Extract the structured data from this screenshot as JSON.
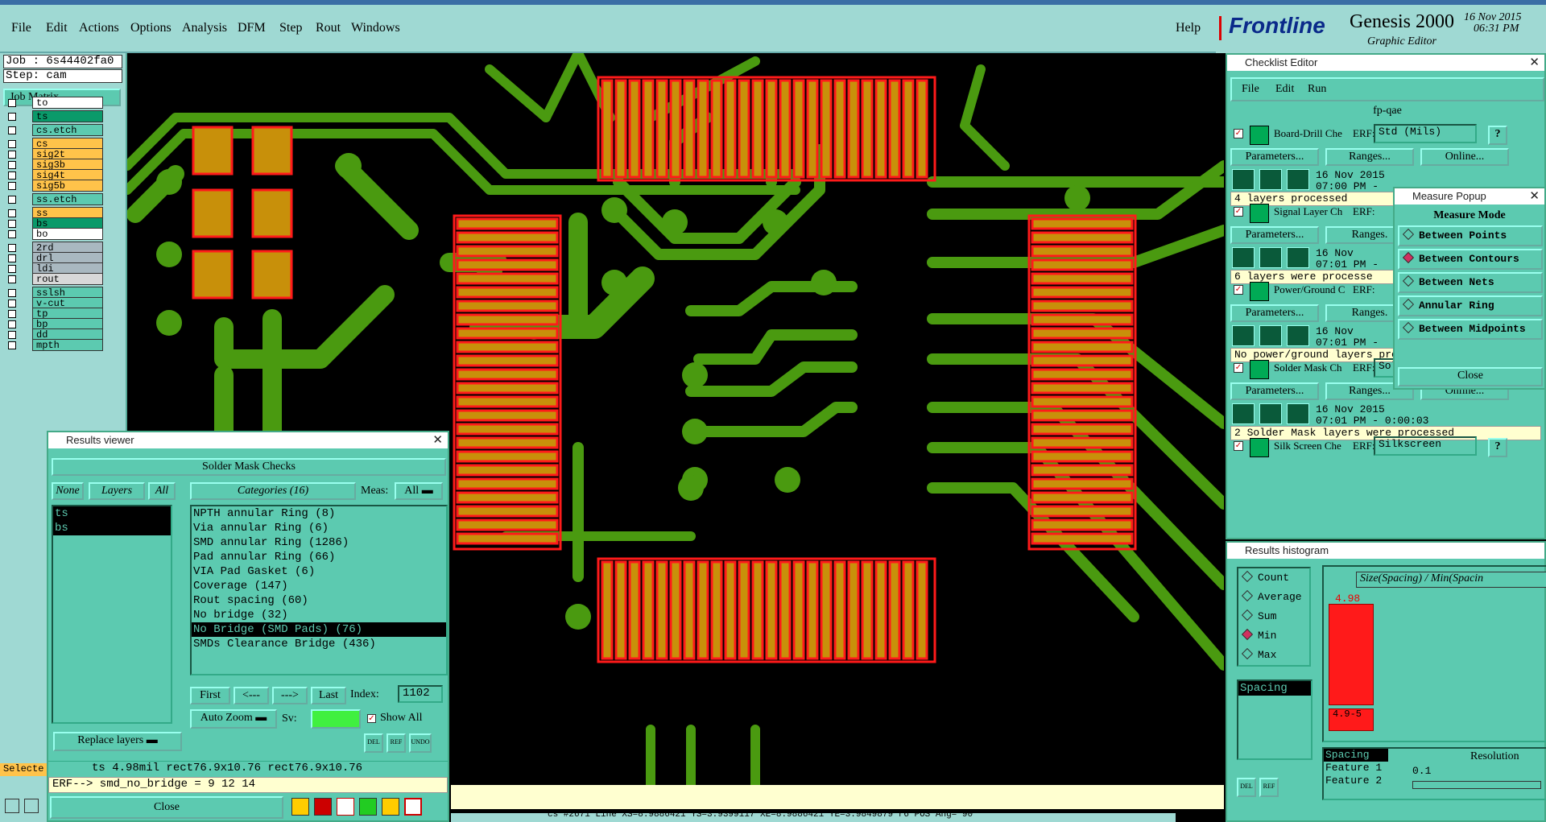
{
  "menu": {
    "items": [
      "File",
      "Edit",
      "Actions",
      "Options",
      "Analysis",
      "DFM",
      "Step",
      "Rout",
      "Windows"
    ],
    "help": "Help"
  },
  "brand": {
    "logo": "Frontline",
    "product": "Genesis 2000",
    "subtitle": "Graphic Editor",
    "date": "16 Nov 2015",
    "time": "06:31 PM"
  },
  "left": {
    "job": "Job : 6s44402fa0",
    "step": "Step: cam",
    "job_matrix": "Job Matrix ...",
    "layers": [
      {
        "name": "to",
        "color": "#ffffff"
      },
      {
        "name": "ts",
        "color": "#0a9a6a"
      },
      {
        "name": "cs.etch",
        "color": "#5ccab0"
      },
      {
        "name": "cs",
        "color": "#ffc34a"
      },
      {
        "name": "sig2t",
        "color": "#ffc34a"
      },
      {
        "name": "sig3b",
        "color": "#ffc34a"
      },
      {
        "name": "sig4t",
        "color": "#ffc34a"
      },
      {
        "name": "sig5b",
        "color": "#ffc34a"
      },
      {
        "name": "ss.etch",
        "color": "#5ccab0"
      },
      {
        "name": "ss",
        "color": "#ffc34a"
      },
      {
        "name": "bs",
        "color": "#0a9a6a"
      },
      {
        "name": "bo",
        "color": "#ffffff"
      },
      {
        "name": "2rd",
        "color": "#a9b8c0"
      },
      {
        "name": "drl",
        "color": "#a9b8c0"
      },
      {
        "name": "ldi",
        "color": "#a9b8c0"
      },
      {
        "name": "rout",
        "color": "#d8d8d8"
      },
      {
        "name": "sslsh",
        "color": "#5ccab0"
      },
      {
        "name": "v-cut",
        "color": "#5ccab0"
      },
      {
        "name": "tp",
        "color": "#5ccab0"
      },
      {
        "name": "bp",
        "color": "#5ccab0"
      },
      {
        "name": "dd",
        "color": "#5ccab0"
      },
      {
        "name": "mpth",
        "color": "#5ccab0"
      }
    ],
    "select_label": "Selecte"
  },
  "results_viewer": {
    "title": "Results viewer",
    "header": "Solder Mask Checks",
    "none_btn": "None",
    "layers_btn": "Layers",
    "all_btn": "All",
    "categories_label": "Categories (16)",
    "meas_label": "Meas:",
    "meas_value": "All",
    "layer_list": [
      "ts",
      "bs"
    ],
    "categories": [
      "NPTH annular Ring (8)",
      "Via annular Ring (6)",
      "SMD annular Ring (1286)",
      "Pad annular Ring (66)",
      "VIA Pad Gasket (6)",
      "Coverage (147)",
      "Rout spacing (60)",
      "No bridge (32)",
      "No Bridge (SMD Pads) (76)",
      "SMDs Clearance Bridge (436)"
    ],
    "selected_category": 8,
    "first": "First",
    "prev": "<---",
    "next": "--->",
    "last": "Last",
    "index_label": "Index:",
    "index_value": "1102",
    "auto_zoom": "Auto Zoom",
    "sv_label": "Sv:",
    "show_all": "Show All",
    "replace_layers": "Replace layers",
    "info_line": "ts 4.98mil   rect76.9x10.76   rect76.9x10.76",
    "erf_line": "ERF--> smd_no_bridge = 9 12 14",
    "close": "Close",
    "icons": [
      "DEL",
      "REF",
      "UNDO"
    ]
  },
  "checklist": {
    "title": "Checklist Editor",
    "menu": [
      "File",
      "Edit",
      "Run"
    ],
    "name": "fp-qae",
    "items": [
      {
        "name": "Board-Drill Che",
        "erf": "Std (Mils)",
        "params": "Parameters...",
        "ranges": "Ranges...",
        "online": "Online...",
        "date": "16 Nov 2015",
        "time": "07:00 PM -",
        "status": "4 layers processed"
      },
      {
        "name": "Signal Layer Ch",
        "erf": "",
        "params": "Parameters...",
        "ranges": "Ranges.",
        "online": "",
        "date": "16 Nov",
        "time": "07:01 PM -",
        "status": "6 layers were processe"
      },
      {
        "name": "Power/Ground C",
        "erf": "",
        "params": "Parameters...",
        "ranges": "Ranges.",
        "online": "",
        "date": "16 Nov",
        "time": "07:01 PM -",
        "status": "No power/ground layers processed"
      },
      {
        "name": "Solder Mask Ch",
        "erf": "Soldermask",
        "params": "Parameters...",
        "ranges": "Ranges...",
        "online": "Online...",
        "date": "16 Nov 2015",
        "time": "07:01 PM - 0:00:03",
        "status": "2 Solder Mask layers were processed"
      },
      {
        "name": "Silk Screen Che",
        "erf": "Silkscreen",
        "params": "",
        "ranges": "",
        "online": "",
        "date": "",
        "time": "",
        "status": ""
      }
    ],
    "erf_label": "ERF:"
  },
  "measure": {
    "title": "Measure Popup",
    "mode_label": "Measure Mode",
    "modes": [
      "Between Points",
      "Between Contours",
      "Between Nets",
      "Annular Ring",
      "Between Midpoints"
    ],
    "selected": 1,
    "close": "Close"
  },
  "histogram": {
    "title": "Results histogram",
    "options": [
      "Count",
      "Average",
      "Sum",
      "Min",
      "Max"
    ],
    "selected": 3,
    "chart_title": "Size(Spacing) / Min(Spacin",
    "bar_value": "4.98",
    "bar_bin": "4.9-5",
    "list": [
      "Spacing"
    ],
    "fields": [
      "Spacing",
      "Feature 1",
      "Feature 2"
    ],
    "resolution_label": "Resolution",
    "resolution_value": "0.1",
    "icons": [
      "DEL",
      "REF"
    ]
  },
  "statusbar": {
    "text": "cs #2671 Line XS=8.9886421 YS=3.9399117 XE=8.9886421 YE=3.9849879 r6 POS Ang= 90"
  },
  "colors": {
    "panel": "#5ccab0",
    "panel_light": "#9fd9d3",
    "trace": "#4a9a10",
    "pad": "#c8900a",
    "outline": "#ff1a1a"
  }
}
